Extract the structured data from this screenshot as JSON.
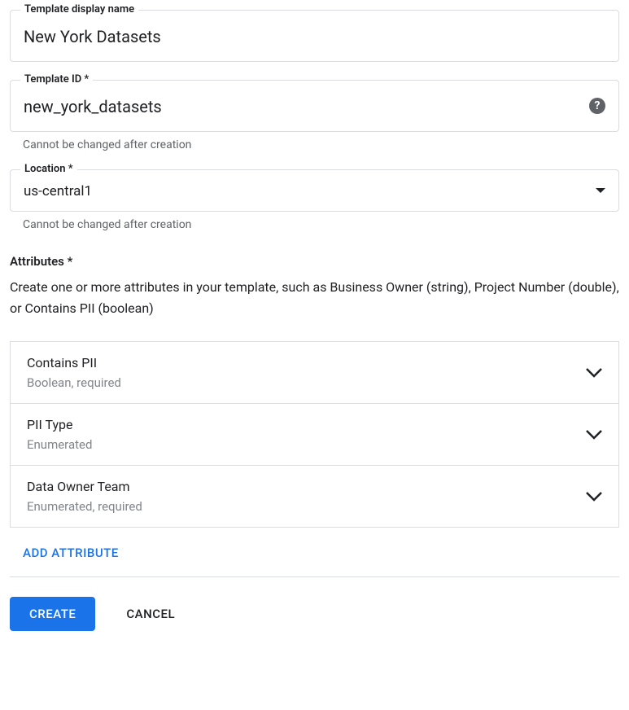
{
  "fields": {
    "displayName": {
      "label": "Template display name",
      "value": "New York Datasets"
    },
    "templateId": {
      "label": "Template ID *",
      "value": "new_york_datasets",
      "helper": "Cannot be changed after creation"
    },
    "location": {
      "label": "Location *",
      "value": "us-central1",
      "helper": "Cannot be changed after creation"
    }
  },
  "attributesSection": {
    "heading": "Attributes *",
    "description": "Create one or more attributes in your template, such as Business Owner (string), Project Number (double), or Contains PII (boolean)"
  },
  "attributes": [
    {
      "name": "Contains PII",
      "type": "Boolean, required"
    },
    {
      "name": "PII Type",
      "type": "Enumerated"
    },
    {
      "name": "Data Owner Team",
      "type": "Enumerated, required"
    }
  ],
  "buttons": {
    "addAttribute": "ADD ATTRIBUTE",
    "create": "CREATE",
    "cancel": "CANCEL"
  },
  "icons": {
    "help": "?",
    "dropdown": "▼"
  }
}
